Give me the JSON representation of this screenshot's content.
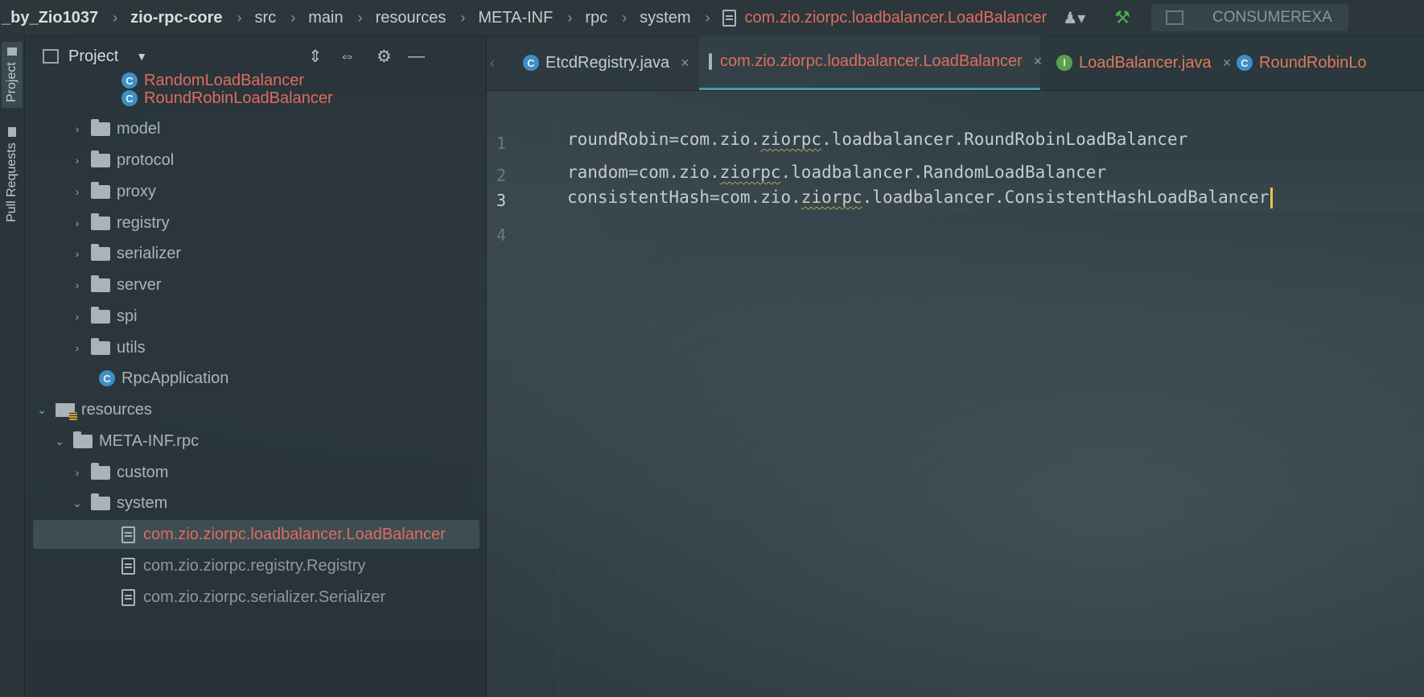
{
  "breadcrumb": {
    "project_tail": "_by_Zio1037",
    "module": "zio-rpc-core",
    "parts": [
      "src",
      "main",
      "resources",
      "META-INF",
      "rpc",
      "system"
    ],
    "file": "com.zio.ziorpc.loadbalancer.LoadBalancer",
    "run_config": "CONSUMEREXA"
  },
  "side_tabs": [
    "Project",
    "Pull Requests"
  ],
  "project_panel": {
    "title": "Project",
    "items": [
      {
        "label": "RandomLoadBalancer",
        "kind": "class",
        "color": "red"
      },
      {
        "label": "RoundRobinLoadBalancer",
        "kind": "class",
        "color": "red"
      },
      {
        "label": "model",
        "kind": "folder"
      },
      {
        "label": "protocol",
        "kind": "folder"
      },
      {
        "label": "proxy",
        "kind": "folder"
      },
      {
        "label": "registry",
        "kind": "folder"
      },
      {
        "label": "serializer",
        "kind": "folder"
      },
      {
        "label": "server",
        "kind": "folder"
      },
      {
        "label": "spi",
        "kind": "folder"
      },
      {
        "label": "utils",
        "kind": "folder"
      },
      {
        "label": "RpcApplication",
        "kind": "class"
      },
      {
        "label": "resources",
        "kind": "resources"
      },
      {
        "label": "META-INF.rpc",
        "kind": "folder"
      },
      {
        "label": "custom",
        "kind": "folder"
      },
      {
        "label": "system",
        "kind": "folder"
      },
      {
        "label": "com.zio.ziorpc.loadbalancer.LoadBalancer",
        "kind": "file",
        "color": "red",
        "selected": true
      },
      {
        "label": "com.zio.ziorpc.registry.Registry",
        "kind": "file",
        "color": "dim"
      },
      {
        "label": "com.zio.ziorpc.serializer.Serializer",
        "kind": "file",
        "color": "dim"
      }
    ]
  },
  "tabs": [
    {
      "label": "EtcdRegistry.java",
      "icon": "class"
    },
    {
      "label": "com.zio.ziorpc.loadbalancer.LoadBalancer",
      "icon": "file",
      "active": true
    },
    {
      "label": "LoadBalancer.java",
      "icon": "interface"
    },
    {
      "label": "RoundRobinLo",
      "icon": "class"
    }
  ],
  "editor": {
    "line_numbers": [
      "1",
      "2",
      "3",
      "4"
    ],
    "lines": [
      {
        "pre": "roundRobin=com.zio.",
        "sq": "ziorpc",
        "post": ".loadbalancer.RoundRobinLoadBalancer"
      },
      {
        "pre": "random=com.zio.",
        "sq": "ziorpc",
        "post": ".loadbalancer.RandomLoadBalancer"
      },
      {
        "pre": "consistentHash=com.zio.",
        "sq": "ziorpc",
        "post": ".loadbalancer.ConsistentHashLoadBalancer"
      }
    ],
    "current_line": "3"
  },
  "colors": {
    "accent": "#4a9aa0",
    "modified": "#e06c5e",
    "caret": "#f0c340",
    "class_icon": "#3d8fc4",
    "interface_icon": "#5aa04c"
  }
}
